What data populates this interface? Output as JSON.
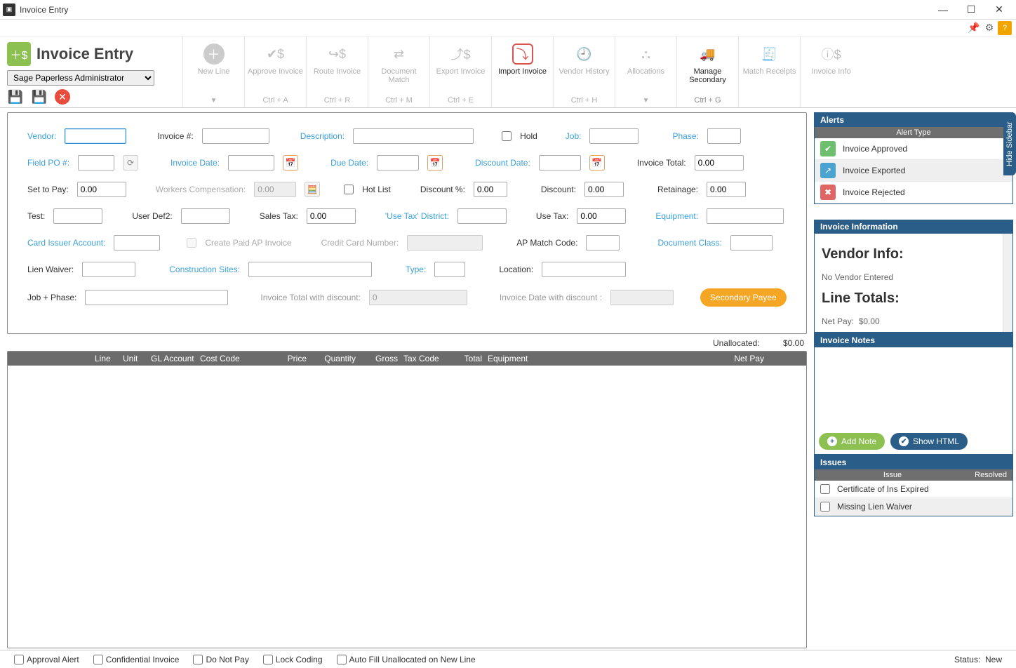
{
  "window": {
    "title": "Invoice Entry"
  },
  "ribbon": {
    "page_title": "Invoice Entry",
    "user": "Sage Paperless Administrator",
    "items": [
      {
        "label": "New Line",
        "shortcut": "",
        "drop": "▼"
      },
      {
        "label": "Approve Invoice",
        "shortcut": "Ctrl + A"
      },
      {
        "label": "Route Invoice",
        "shortcut": "Ctrl + R"
      },
      {
        "label": "Document Match",
        "shortcut": "Ctrl + M"
      },
      {
        "label": "Export Invoice",
        "shortcut": "Ctrl + E"
      },
      {
        "label": "Import Invoice",
        "shortcut": ""
      },
      {
        "label": "Vendor History",
        "shortcut": "Ctrl + H"
      },
      {
        "label": "Allocations",
        "shortcut": "",
        "drop": "▼"
      },
      {
        "label": "Manage Secondary",
        "shortcut": "Ctrl + G"
      },
      {
        "label": "Match Receipts",
        "shortcut": ""
      },
      {
        "label": "Invoice Info",
        "shortcut": ""
      }
    ]
  },
  "form": {
    "labels": {
      "vendor": "Vendor:",
      "invoice_no": "Invoice #:",
      "description": "Description:",
      "hold": "Hold",
      "job": "Job:",
      "phase": "Phase:",
      "field_po": "Field PO #:",
      "invoice_date": "Invoice Date:",
      "due_date": "Due Date:",
      "discount_date": "Discount Date:",
      "invoice_total": "Invoice Total:",
      "set_to_pay": "Set to Pay:",
      "workers_comp": "Workers Compensation:",
      "hot_list": "Hot List",
      "discount_pct": "Discount %:",
      "discount": "Discount:",
      "retainage": "Retainage:",
      "test": "Test:",
      "user_def2": "User Def2:",
      "sales_tax": "Sales Tax:",
      "use_tax_district": "'Use Tax' District:",
      "use_tax": "Use Tax:",
      "equipment": "Equipment:",
      "card_issuer": "Card Issuer Account:",
      "create_paid_ap": "Create Paid AP Invoice",
      "cc_number": "Credit Card Number:",
      "ap_match": "AP Match Code:",
      "doc_class": "Document Class:",
      "lien_waiver": "Lien Waiver:",
      "construction_sites": "Construction Sites:",
      "type": "Type:",
      "location": "Location:",
      "job_phase": "Job + Phase:",
      "inv_total_disc": "Invoice Total with discount:",
      "inv_date_disc": "Invoice Date with discount :",
      "secondary_payee": "Secondary Payee"
    },
    "values": {
      "invoice_total": "0.00",
      "set_to_pay": "0.00",
      "workers_comp": "0.00",
      "discount_pct": "0.00",
      "discount": "0.00",
      "retainage": "0.00",
      "sales_tax": "0.00",
      "use_tax": "0.00",
      "inv_total_disc": "0"
    },
    "unallocated_label": "Unallocated:",
    "unallocated_value": "$0.00"
  },
  "grid": {
    "columns": [
      "Line",
      "Unit",
      "GL Account",
      "Cost Code",
      "Price",
      "Quantity",
      "Gross",
      "Tax Code",
      "Total",
      "Equipment",
      "Net Pay"
    ]
  },
  "footer": {
    "checks": [
      "Approval Alert",
      "Confidential Invoice",
      "Do Not Pay",
      "Lock Coding",
      "Auto Fill Unallocated on New Line"
    ],
    "status_label": "Status:",
    "status_value": "New"
  },
  "alerts": {
    "header": "Alerts",
    "sub": "Alert Type",
    "items": [
      "Invoice Approved",
      "Invoice Exported",
      "Invoice Rejected"
    ]
  },
  "info": {
    "header": "Invoice Information",
    "vendor_title": "Vendor Info:",
    "vendor_text": "No Vendor Entered",
    "line_totals": "Line Totals:",
    "net_pay_label": "Net Pay:",
    "net_pay_value": "$0.00"
  },
  "notes": {
    "header": "Invoice Notes",
    "add": "Add Note",
    "show_html": "Show HTML"
  },
  "issues": {
    "header": "Issues",
    "col_issue": "Issue",
    "col_resolved": "Resolved",
    "items": [
      "Certificate of Ins Expired",
      "Missing Lien Waiver"
    ]
  },
  "sidebar_tab": "Hide Sidebar"
}
